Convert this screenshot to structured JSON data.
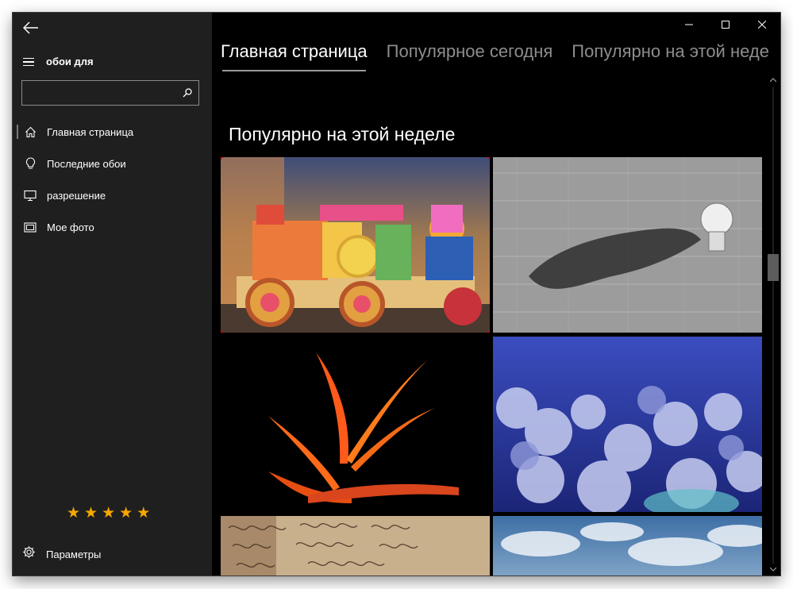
{
  "app": {
    "title": "обои для"
  },
  "search": {
    "placeholder": "",
    "value": ""
  },
  "sidebar": {
    "items": [
      {
        "label": "Главная страница",
        "icon": "home-icon",
        "active": true
      },
      {
        "label": "Последние обои",
        "icon": "lightbulb-icon",
        "active": false
      },
      {
        "label": "разрешение",
        "icon": "monitor-icon",
        "active": false
      },
      {
        "label": "Мое фото",
        "icon": "photo-icon",
        "active": false
      }
    ],
    "rating": {
      "stars": "★★★★★",
      "value": 5,
      "max": 5
    },
    "settings_label": "Параметры"
  },
  "tabs": [
    {
      "label": "Главная страница",
      "active": true
    },
    {
      "label": "Популярное сегодня",
      "active": false
    },
    {
      "label": "Популярно на этой неде",
      "active": false
    }
  ],
  "section": {
    "title": "Популярно на этой неделе"
  },
  "tiles": [
    {
      "name": "wallpaper-toy-train",
      "selected": true
    },
    {
      "name": "wallpaper-lightbulb-shadow",
      "selected": false
    },
    {
      "name": "wallpaper-bird-of-paradise",
      "selected": false
    },
    {
      "name": "wallpaper-coral-reef",
      "selected": false
    },
    {
      "name": "wallpaper-handwritten-letter",
      "selected": false
    },
    {
      "name": "wallpaper-cloudy-sky",
      "selected": false
    }
  ],
  "colors": {
    "sidebar_bg": "#1f1f1f",
    "content_bg": "#000000",
    "highlight": "#e3000f",
    "stars": "#f6a800"
  }
}
